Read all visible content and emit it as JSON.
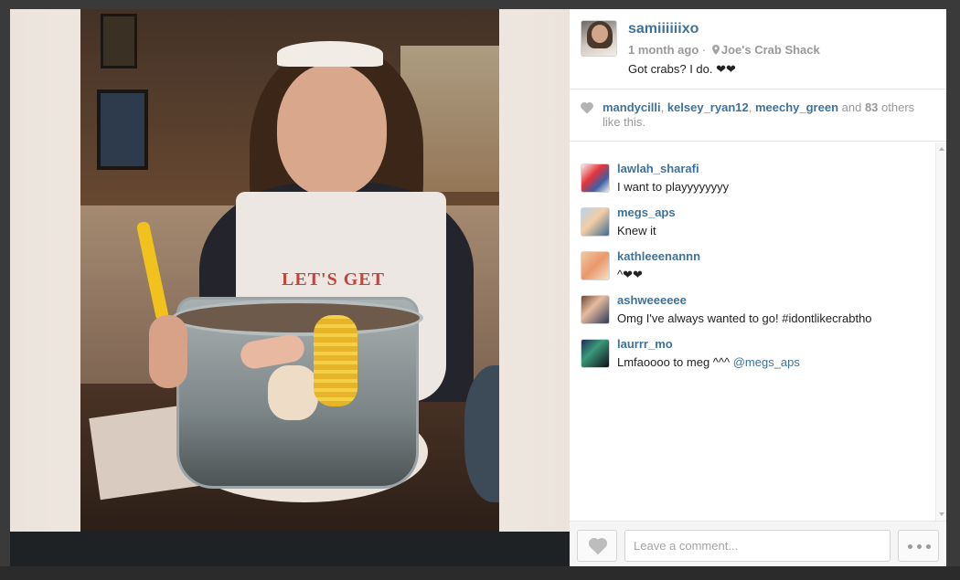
{
  "post": {
    "username": "samiiiiiixo",
    "time": "1 month ago",
    "separator": "·",
    "location": "Joe's Crab Shack",
    "caption": "Got crabs? I do. ❤❤",
    "photo_bib_text": "LET'S GET"
  },
  "likes": {
    "users": [
      "mandycilli",
      "kelsey_ryan12",
      "meechy_green"
    ],
    "sep1": ", ",
    "sep2": ", ",
    "and_text": " and ",
    "count": "83",
    "suffix_line1": " others",
    "suffix_line2": "like this."
  },
  "comments": [
    {
      "user": "lawlah_sharafi",
      "text": "I want to playyyyyyyy"
    },
    {
      "user": "megs_aps",
      "text": "Knew it"
    },
    {
      "user": "kathleeenannn",
      "text": "^❤❤"
    },
    {
      "user": "ashweeeeee",
      "text": "Omg I've always wanted to go! #idontlikecrabtho"
    },
    {
      "user": "laurrr_mo",
      "text": "Lmfaoooo to meg ^^^ ",
      "mention": "@megs_aps"
    }
  ],
  "footer": {
    "comment_placeholder": "Leave a comment..."
  },
  "colors": {
    "link": "#3f729b",
    "muted": "#999999",
    "panel_bg": "#ffffff"
  },
  "icons": {
    "location": "pin-icon",
    "like": "heart-icon",
    "more": "ellipsis-icon"
  }
}
